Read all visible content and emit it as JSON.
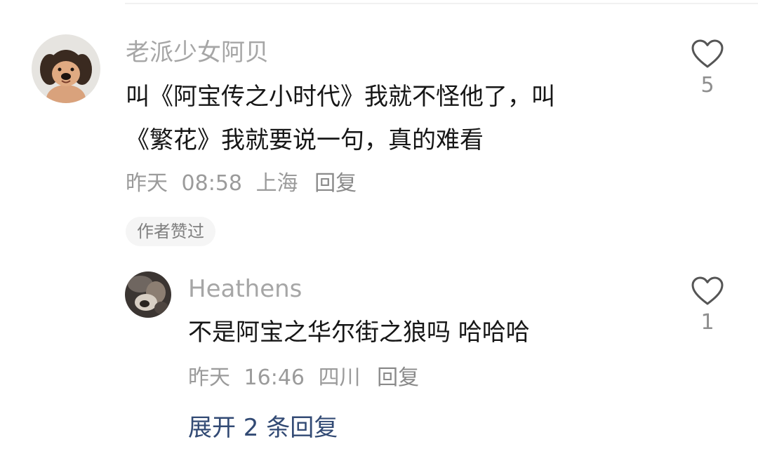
{
  "comment": {
    "username": "老派少女阿贝",
    "text_line1": "叫《阿宝传之小时代》我就不怪他了，叫",
    "text_line2": "《繁花》我就要说一句，真的难看",
    "date": "昨天",
    "time": "08:58",
    "location": "上海",
    "reply_label": "回复",
    "author_liked_badge": "作者赞过",
    "like_count": "5",
    "avatar_icon": "plush-dog-avatar"
  },
  "reply": {
    "username": "Heathens",
    "text": "不是阿宝之华尔街之狼吗 哈哈哈",
    "date": "昨天",
    "time": "16:46",
    "location": "四川",
    "reply_label": "回复",
    "like_count": "1",
    "avatar_icon": "dark-photo-avatar"
  },
  "expand_replies": "展开 2 条回复",
  "colors": {
    "username": "#a6a6a6",
    "text": "#161616",
    "meta": "#9b9b9b",
    "link": "#324a74",
    "badge_bg": "#f5f5f5",
    "heart_stroke": "#555555"
  }
}
